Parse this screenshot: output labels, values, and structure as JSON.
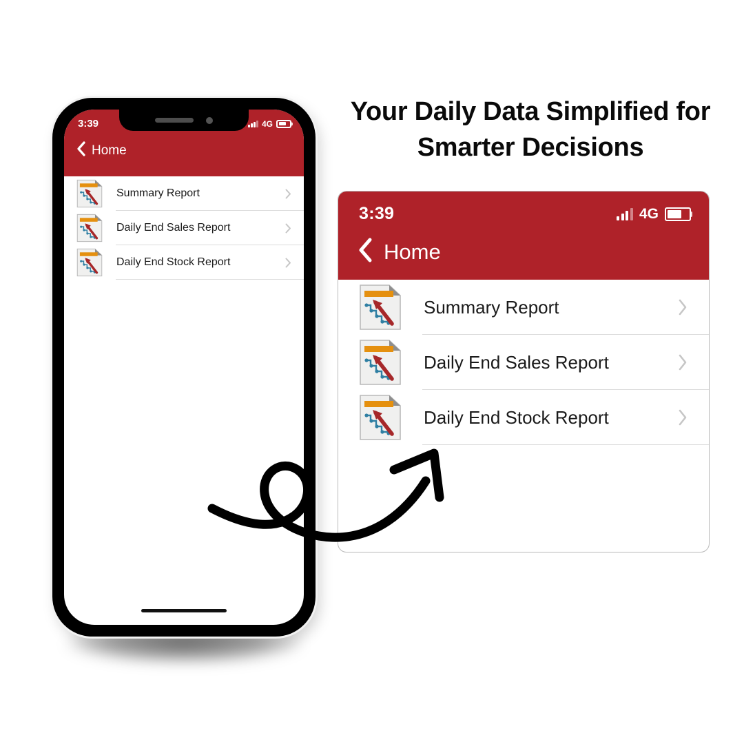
{
  "headline": "Your Daily Data Simplified for Smarter Decisions",
  "colors": {
    "brand_red": "#AF2229",
    "icon_orange": "#E5900F",
    "icon_arrow_red": "#A6282A",
    "icon_line_blue": "#2F7FA3",
    "divider": "#DCDCDC",
    "chevron": "#C6C6C6",
    "page_background": "#FFFFFF"
  },
  "app": {
    "status_bar": {
      "time": "3:39",
      "network_label": "4G",
      "signal_icon": "signal-bars-icon",
      "battery_icon": "battery-icon",
      "battery_level_percent": 68
    },
    "nav_bar": {
      "back_icon": "chevron-left-icon",
      "title": "Home"
    },
    "list": {
      "items": [
        {
          "label": "Summary Report",
          "icon": "report-document-icon",
          "accessory_icon": "chevron-right-icon"
        },
        {
          "label": "Daily End Sales Report",
          "icon": "report-document-icon",
          "accessory_icon": "chevron-right-icon"
        },
        {
          "label": "Daily End Stock Report",
          "icon": "report-document-icon",
          "accessory_icon": "chevron-right-icon"
        }
      ]
    }
  },
  "phone_mockup": {
    "notch_speaker_icon": "speaker-grille-icon",
    "notch_camera_icon": "front-camera-icon",
    "home_indicator_icon": "home-indicator-bar",
    "side_buttons": [
      "silent-switch",
      "volume-up-button",
      "volume-down-button",
      "power-button"
    ]
  },
  "annotation": {
    "arrow_icon": "curved-looping-arrow"
  }
}
